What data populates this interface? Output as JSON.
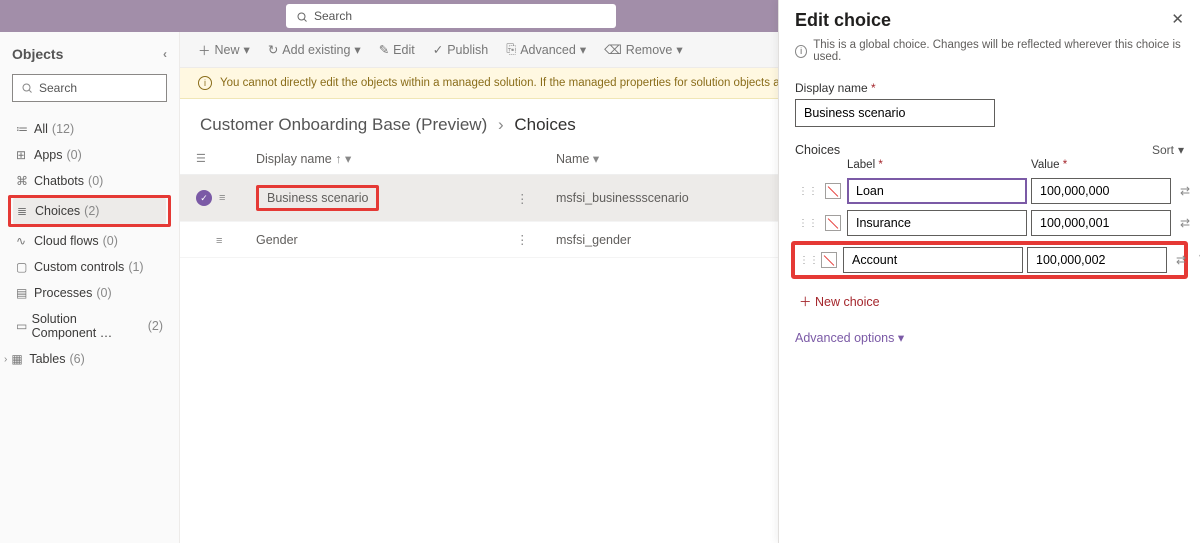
{
  "appbar": {
    "search_placeholder": "Search"
  },
  "side": {
    "title": "Objects",
    "search_placeholder": "Search",
    "items": [
      {
        "label": "All",
        "count": "(12)",
        "icon": "≔"
      },
      {
        "label": "Apps",
        "count": "(0)",
        "icon": "⊞"
      },
      {
        "label": "Chatbots",
        "count": "(0)",
        "icon": "⌘"
      },
      {
        "label": "Choices",
        "count": "(2)",
        "icon": "≣"
      },
      {
        "label": "Cloud flows",
        "count": "(0)",
        "icon": "∿"
      },
      {
        "label": "Custom controls",
        "count": "(1)",
        "icon": "▢"
      },
      {
        "label": "Processes",
        "count": "(0)",
        "icon": "▤"
      },
      {
        "label": "Solution Component …",
        "count": "(2)",
        "icon": "▭"
      },
      {
        "label": "Tables",
        "count": "(6)",
        "icon": "▦"
      }
    ]
  },
  "cmd": {
    "new": "New",
    "add_existing": "Add existing",
    "edit": "Edit",
    "publish": "Publish",
    "advanced": "Advanced",
    "remove": "Remove"
  },
  "banner": "You cannot directly edit the objects within a managed solution. If the managed properties for solution objects are set to allow customization, you can e",
  "crumbs": {
    "parent": "Customer Onboarding Base (Preview)",
    "current": "Choices"
  },
  "grid": {
    "col_display": "Display name",
    "col_name": "Name",
    "rows": [
      {
        "display": "Business scenario",
        "name": "msfsi_businessscenario",
        "selected": true
      },
      {
        "display": "Gender",
        "name": "msfsi_gender",
        "selected": false
      }
    ]
  },
  "panel": {
    "title": "Edit choice",
    "info": "This is a global choice. Changes will be reflected wherever this choice is used.",
    "display_label": "Display name",
    "display_value": "Business scenario",
    "choices_label": "Choices",
    "sort_label": "Sort",
    "col_label": "Label",
    "col_value": "Value",
    "rows": [
      {
        "label": "Loan",
        "value": "100,000,000"
      },
      {
        "label": "Insurance",
        "value": "100,000,001"
      },
      {
        "label": "Account",
        "value": "100,000,002"
      }
    ],
    "new_choice": "New choice",
    "advanced": "Advanced options"
  }
}
